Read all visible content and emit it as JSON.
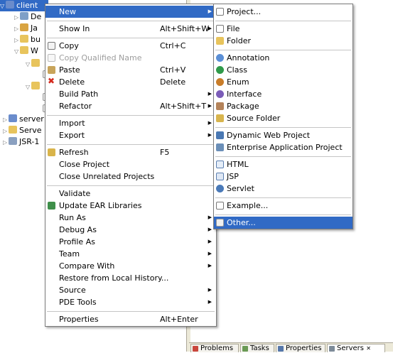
{
  "tree": {
    "rows": [
      {
        "label": "client",
        "twisty": "▽"
      },
      {
        "label": "De",
        "twisty": "▷"
      },
      {
        "label": "Ja",
        "twisty": "▷"
      },
      {
        "label": "bu",
        "twisty": "▷"
      },
      {
        "label": "W",
        "twisty": "▽"
      },
      {
        "label": "",
        "twisty": "▽"
      },
      {
        "label": "",
        "twisty": ""
      },
      {
        "label": "",
        "twisty": "▽"
      },
      {
        "label": "",
        "twisty": ""
      },
      {
        "label": "",
        "twisty": ""
      },
      {
        "label": "server",
        "twisty": "▷"
      },
      {
        "label": "Serve",
        "twisty": "▷"
      },
      {
        "label": "JSR-1",
        "twisty": "▷"
      }
    ]
  },
  "context_menu": {
    "new": "New",
    "show_in": "Show In",
    "show_in_sc": "Alt+Shift+W",
    "copy": "Copy",
    "copy_sc": "Ctrl+C",
    "copy_qualified": "Copy Qualified Name",
    "paste": "Paste",
    "paste_sc": "Ctrl+V",
    "delete": "Delete",
    "delete_sc": "Delete",
    "build_path": "Build Path",
    "refactor": "Refactor",
    "refactor_sc": "Alt+Shift+T",
    "import": "Import",
    "export": "Export",
    "refresh": "Refresh",
    "refresh_sc": "F5",
    "close_project": "Close Project",
    "close_unrelated": "Close Unrelated Projects",
    "validate": "Validate",
    "update_ear": "Update EAR Libraries",
    "run_as": "Run As",
    "debug_as": "Debug As",
    "profile_as": "Profile As",
    "team": "Team",
    "compare_with": "Compare With",
    "restore_history": "Restore from Local History...",
    "source": "Source",
    "pde_tools": "PDE Tools",
    "properties": "Properties",
    "properties_sc": "Alt+Enter"
  },
  "new_submenu": {
    "project": "Project...",
    "file": "File",
    "folder": "Folder",
    "annotation": "Annotation",
    "class": "Class",
    "enum": "Enum",
    "interface": "Interface",
    "package": "Package",
    "source_folder": "Source Folder",
    "dynamic_web_project": "Dynamic Web Project",
    "enterprise_app_project": "Enterprise Application Project",
    "html": "HTML",
    "jsp": "JSP",
    "servlet": "Servlet",
    "example": "Example...",
    "other": "Other..."
  },
  "bottom_tabs": {
    "problems": "Problems",
    "tasks": "Tasks",
    "properties": "Properties",
    "servers": "Servers",
    "servers_close": "✕"
  }
}
